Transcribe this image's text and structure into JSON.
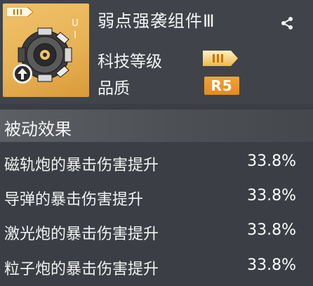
{
  "item": {
    "title": "弱点强袭组件Ⅲ",
    "icon_vertical_text": "U\nI",
    "tier_icon": "tier-three-chevron-icon",
    "component_icon": "mechanical-component-icon",
    "upgrade_icon": "up-arrow-icon",
    "share_icon": "share-icon"
  },
  "info": {
    "tech_level_label": "科技等级",
    "quality_label": "品质",
    "quality_value": "R5"
  },
  "passive": {
    "header": "被动效果",
    "effects": [
      {
        "name": "磁轨炮的暴击伤害提升",
        "value": "33.8%"
      },
      {
        "name": "导弹的暴击伤害提升",
        "value": "33.8%"
      },
      {
        "name": "激光炮的暴击伤害提升",
        "value": "33.8%"
      },
      {
        "name": "粒子炮的暴击伤害提升",
        "value": "33.8%"
      }
    ]
  },
  "colors": {
    "panel": "#3b3f45",
    "gold": "#e8b256",
    "orange": "#e48a1e"
  }
}
